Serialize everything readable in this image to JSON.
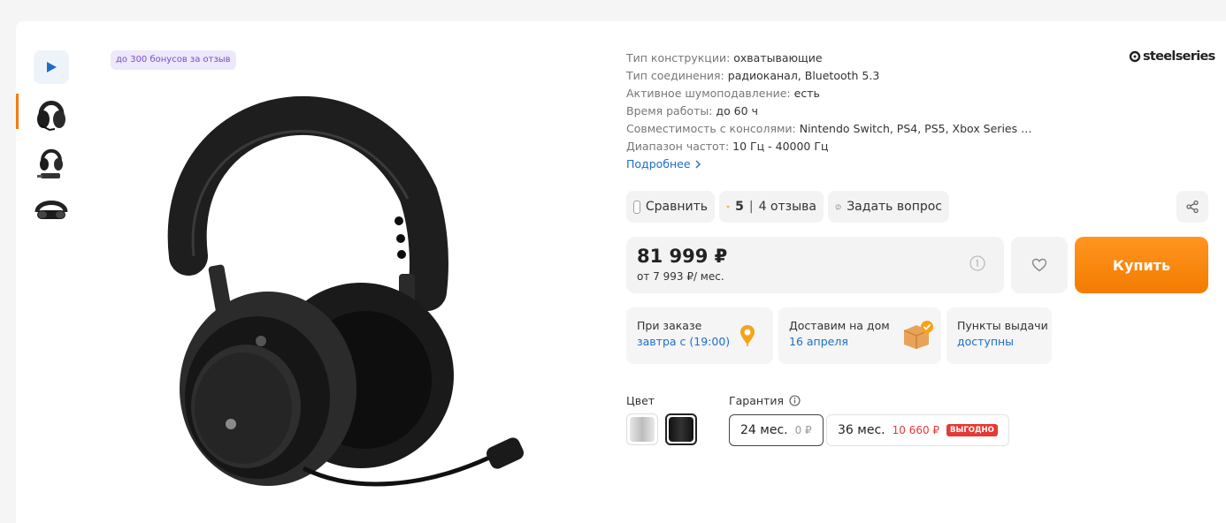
{
  "bonus_badge": "до 300 бонусов за отзыв",
  "brand": {
    "name": "steelseries"
  },
  "specs": [
    {
      "key": "Тип конструкции:",
      "value": "охватывающие"
    },
    {
      "key": "Тип соединения:",
      "value": "радиоканал, Bluetooth 5.3"
    },
    {
      "key": "Активное шумоподавление:",
      "value": "есть"
    },
    {
      "key": "Время работы:",
      "value": "до 60 ч"
    },
    {
      "key": "Совместимость с консолями:",
      "value": "Nintendo Switch, PS4, PS5, Xbox Series …"
    },
    {
      "key": "Диапазон частот:",
      "value": "10 Гц - 40000 Гц"
    }
  ],
  "more_link": "Подробнее",
  "actions": {
    "compare_label": "Сравнить",
    "rating_value": "5",
    "separator": "|",
    "reviews_label": "4 отзыва",
    "ask_label": "Задать вопрос"
  },
  "price": {
    "main": "81 999 ₽",
    "installment": "от 7 993 ₽/ мес."
  },
  "buy_label": "Купить",
  "delivery": [
    {
      "title": "При заказе",
      "link": "завтра с (19:00)"
    },
    {
      "title": "Доставим на дом",
      "link": "16 апреля"
    },
    {
      "title": "Пункты выдачи",
      "link": "доступны"
    }
  ],
  "color": {
    "label": "Цвет",
    "options": [
      {
        "name": "white",
        "color": "#d9d9d9"
      },
      {
        "name": "black",
        "color": "#1a1a1a"
      }
    ]
  },
  "warranty": {
    "label": "Гарантия",
    "options": [
      {
        "term": "24 мес.",
        "price": "0 ₽"
      },
      {
        "term": "36 мес.",
        "price": "10 660 ₽",
        "badge": "ВЫГОДНО"
      }
    ]
  },
  "colors": {
    "accent": "#f37c00",
    "link": "#1c6fc9",
    "badge_bg": "#ede8fb",
    "badge_text": "#7a4ec7",
    "deal": "#e53935"
  }
}
